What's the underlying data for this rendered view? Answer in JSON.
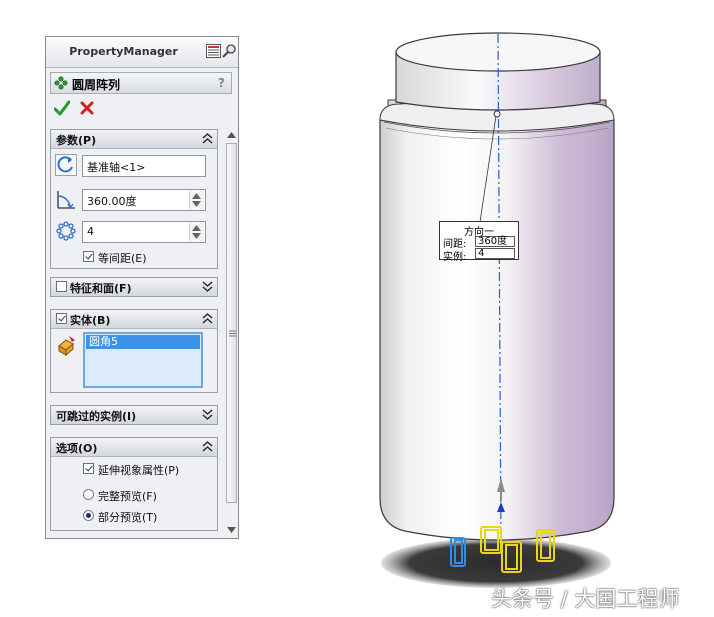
{
  "property_manager": {
    "title": "PropertyManager",
    "feature_name": "圆周阵列",
    "help_glyph": "?",
    "groups": {
      "params": {
        "label": "参数(P)",
        "axis_value": "基准轴<1>",
        "angle_value": "360.00度",
        "count_value": "4",
        "equal_spacing_label": "等间距(E)"
      },
      "features_faces": {
        "label": "特征和面(F)"
      },
      "bodies": {
        "label": "实体(B)",
        "items": [
          "圆角5"
        ]
      },
      "skip_instances": {
        "label": "可跳过的实例(I)"
      },
      "options": {
        "label": "选项(O)",
        "propagate_label": "延伸视象属性(P)",
        "full_preview_label": "完整预览(F)",
        "partial_preview_label": "部分预览(T)"
      }
    }
  },
  "callout": {
    "title": "方向一",
    "spacing_label": "间距:",
    "spacing_value": "360度",
    "instances_label": "实例:",
    "instances_value": "4"
  },
  "watermark": "头条号 / 大国工程师",
  "colors": {
    "accent_blue": "#1f6fd6",
    "ok_green": "#1f9a2c",
    "cancel_red": "#d42020",
    "preview_yellow": "#f2e21a",
    "selected_body": "#3d92ea",
    "body_lilac": "#c9b6d3"
  }
}
